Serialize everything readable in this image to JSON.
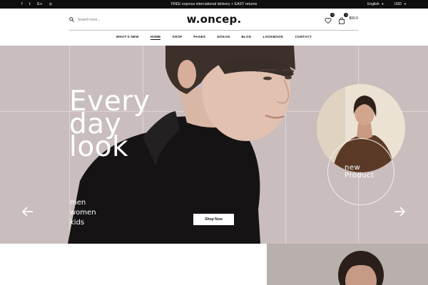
{
  "topbar": {
    "social_icons": [
      "facebook-icon",
      "twitter-icon",
      "google-plus-icon",
      "instagram-icon"
    ],
    "social_glyphs": [
      "f",
      "t",
      "G+",
      "◎"
    ],
    "promo": "FREE express international delivery + EASY returns",
    "language": "English",
    "currency": "USD"
  },
  "header": {
    "search_placeholder": "Search here...",
    "logo": "w.oncep.",
    "wishlist_count": "0",
    "cart_count": "0",
    "cart_total": "$00.0",
    "nav": [
      "WHAT'S NEW",
      "HOME",
      "SHOP",
      "PAGES",
      "DOKAN",
      "BLOG",
      "LOOKBOOK",
      "CONTACT"
    ],
    "nav_active": "HOME"
  },
  "hero": {
    "headline": [
      "Every",
      "day",
      "look"
    ],
    "categories": [
      "men",
      "women",
      "kids"
    ],
    "cta": "Shop Now",
    "badge": [
      "new",
      "Product"
    ]
  },
  "colors": {
    "topbar_bg": "#0e0e0e",
    "hero_bg": "#c9bdbd",
    "accent": "#111111"
  }
}
